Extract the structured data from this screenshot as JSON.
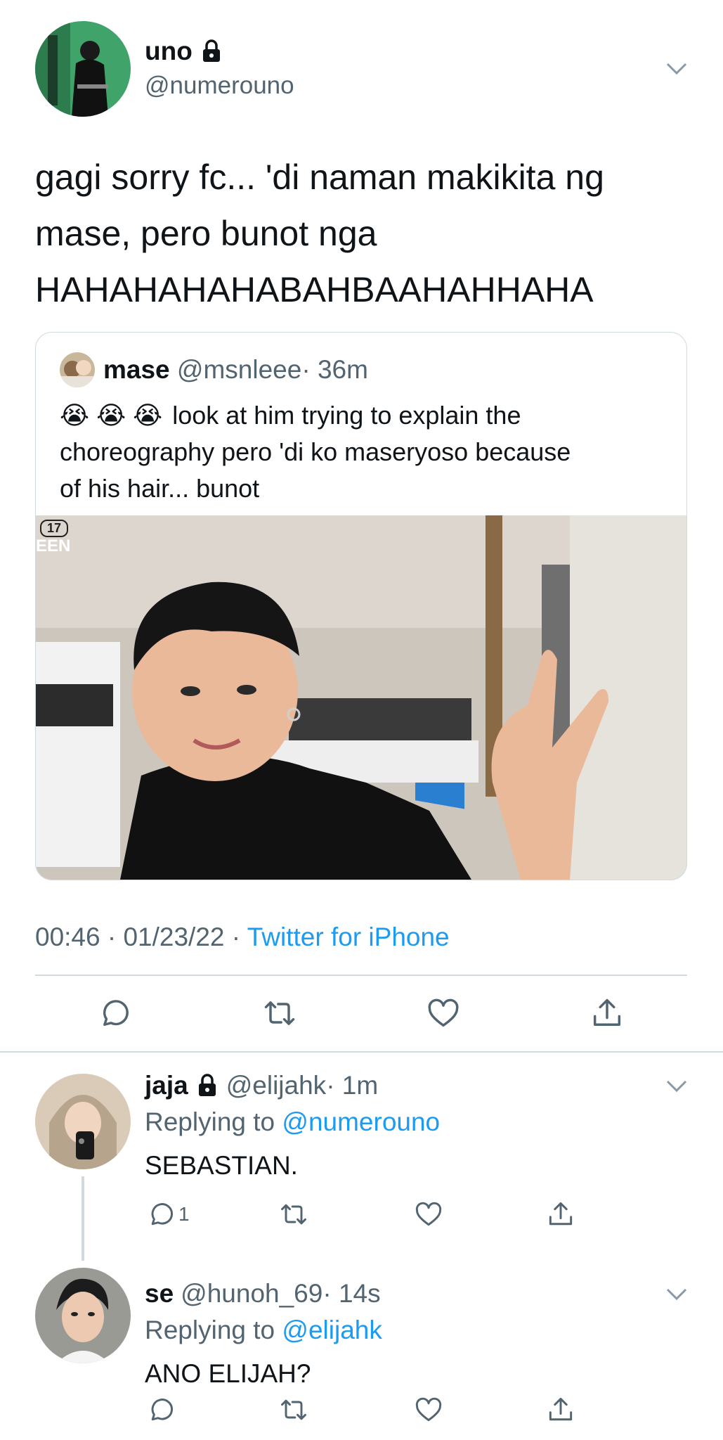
{
  "main_tweet": {
    "name": "uno",
    "handle": "@numerouno",
    "text_lines": [
      "gagi sorry fc... 'di naman makikita ng",
      "mase, pero bunot nga",
      "HAHAHAHAHABAHBAAHAHHAHA"
    ],
    "timestamp": "00:46 · 01/23/22 · ",
    "source": "Twitter for iPhone"
  },
  "quoted_tweet": {
    "name": "mase",
    "handle": "@msnleee",
    "time": "· 36m",
    "emoji": "😭 😭 😭",
    "text_lines": [
      "look at him trying to explain the",
      "choreography pero 'di ko maseryoso because",
      "of his hair... bunot"
    ],
    "video_watermark_top": "17",
    "video_watermark": "EEN"
  },
  "replies": [
    {
      "name": "jaja",
      "handle": "@elijahk",
      "time": "· 1m",
      "replying_prefix": "Replying to ",
      "replying_to": "@numerouno",
      "text": "SEBASTIAN.",
      "reply_count": "1"
    },
    {
      "name": "se",
      "handle": "@hunoh_69",
      "time": "· 14s",
      "replying_prefix": "Replying to ",
      "replying_to": "@elijahk",
      "text": "ANO ELIJAH?",
      "reply_count": ""
    }
  ],
  "icons": [
    "lock-icon",
    "chevron-down-icon",
    "reply-icon",
    "retweet-icon",
    "like-icon",
    "share-icon"
  ],
  "colors": {
    "text": "#0f1419",
    "muted": "#536471",
    "link": "#1d9bf0",
    "divider": "#cfd9de"
  }
}
